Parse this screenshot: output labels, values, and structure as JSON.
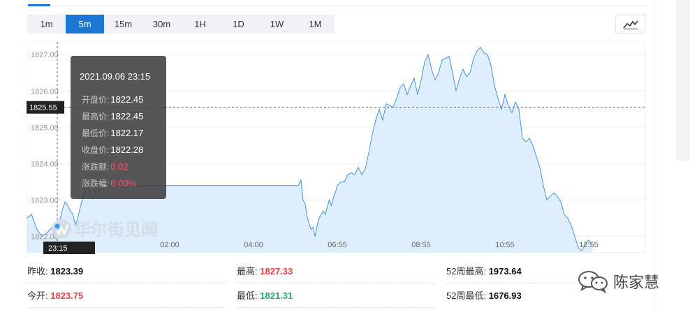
{
  "timeframe_tabs": [
    {
      "label": "1m",
      "active": false
    },
    {
      "label": "5m",
      "active": true
    },
    {
      "label": "15m",
      "active": false
    },
    {
      "label": "30m",
      "active": false
    },
    {
      "label": "1H",
      "active": false
    },
    {
      "label": "1D",
      "active": false
    },
    {
      "label": "1W",
      "active": false
    },
    {
      "label": "1M",
      "active": false
    }
  ],
  "chart_type_icon": "line-chart-icon",
  "chart_data": {
    "type": "area",
    "series": [
      {
        "x": [
          "22:45",
          "22:50",
          "22:55",
          "23:00",
          "23:05",
          "23:10",
          "23:15",
          "23:20",
          "23:25",
          "23:30",
          "23:35",
          "23:40",
          "23:45",
          "23:50",
          "23:55",
          "00:00",
          "00:05",
          "00:10",
          "00:15",
          "00:20",
          "00:25",
          "00:30",
          "01:00",
          "02:00",
          "03:00",
          "04:00",
          "05:00",
          "05:20",
          "05:25",
          "05:30",
          "05:35",
          "05:40",
          "05:45",
          "05:50",
          "05:55",
          "06:00",
          "06:05",
          "06:10",
          "06:15",
          "06:20",
          "06:25",
          "06:30",
          "06:35",
          "06:40",
          "06:45",
          "06:50",
          "06:55",
          "07:00",
          "07:05",
          "07:10",
          "07:15",
          "07:20",
          "07:25",
          "07:30",
          "07:35",
          "07:40",
          "07:45",
          "07:50",
          "07:55",
          "08:00",
          "08:05",
          "08:10",
          "08:15",
          "08:20",
          "08:25",
          "08:30",
          "08:35",
          "08:40",
          "08:45",
          "08:50",
          "08:55",
          "09:00",
          "09:05",
          "09:10",
          "09:15",
          "09:20",
          "09:25",
          "09:30",
          "09:35",
          "09:40",
          "09:45",
          "09:50",
          "09:55",
          "10:00",
          "10:05",
          "10:10",
          "10:15",
          "10:20",
          "10:25",
          "10:30",
          "10:35",
          "10:40",
          "10:45",
          "10:50",
          "10:55",
          "11:00",
          "11:05",
          "11:10",
          "11:15",
          "11:20",
          "11:25",
          "11:30",
          "11:35",
          "11:40",
          "11:45",
          "11:50",
          "11:55",
          "12:00",
          "12:05",
          "12:10",
          "12:15",
          "12:20",
          "12:25",
          "12:30",
          "12:35",
          "12:40",
          "12:45",
          "12:50",
          "12:55",
          "13:00"
        ],
        "values": [
          1822.5,
          1822.6,
          1822.2,
          1822.0,
          1822.1,
          1822.25,
          1822.28,
          1822.45,
          1822.75,
          1822.95,
          1822.85,
          1822.7,
          1822.6,
          1822.3,
          1822.55,
          1822.85,
          1823.15,
          1823.45,
          1823.35,
          1823.1,
          1823.05,
          1823.4,
          1823.4,
          1823.4,
          1823.4,
          1823.4,
          1823.4,
          1823.4,
          1823.55,
          1823.0,
          1822.9,
          1822.55,
          1822.35,
          1822.2,
          1822.25,
          1822.0,
          1822.3,
          1822.5,
          1822.6,
          1822.7,
          1822.6,
          1822.8,
          1823.0,
          1822.85,
          1823.05,
          1823.2,
          1823.4,
          1823.5,
          1823.5,
          1823.7,
          1823.75,
          1823.7,
          1823.9,
          1823.7,
          1823.85,
          1824.3,
          1824.8,
          1825.2,
          1825.5,
          1825.2,
          1825.65,
          1825.6,
          1825.55,
          1825.8,
          1826.1,
          1826.2,
          1825.9,
          1826.15,
          1826.35,
          1825.9,
          1826.3,
          1826.8,
          1827.0,
          1826.6,
          1826.3,
          1826.5,
          1826.85,
          1826.9,
          1826.95,
          1826.5,
          1826.0,
          1826.35,
          1826.6,
          1826.4,
          1826.5,
          1826.9,
          1827.1,
          1827.2,
          1827.05,
          1827.0,
          1826.7,
          1826.15,
          1825.8,
          1825.5,
          1825.9,
          1825.6,
          1825.4,
          1825.7,
          1825.5,
          1824.7,
          1824.6,
          1824.7,
          1824.5,
          1824.2,
          1823.9,
          1823.4,
          1823.0,
          1823.1,
          1823.2,
          1823.1,
          1822.95,
          1822.6,
          1822.5,
          1822.3,
          1822.0,
          1821.7,
          1821.6,
          1821.8,
          1821.9,
          1821.75
        ],
        "fill": "#dfeefc",
        "stroke": "#4a90d9"
      }
    ],
    "ylim": [
      1821.55,
      1827.35
    ],
    "y_ticks": [
      "1822.00",
      "1823.00",
      "1824.00",
      "1825.00",
      "1826.00",
      "1827.00"
    ],
    "x_ticks": [
      "02:00",
      "04:00",
      "06:55",
      "08:55",
      "10:55",
      "12:55"
    ],
    "grid": true,
    "crosshair": {
      "x_label": "23:15",
      "y_label": "1825.55",
      "y_value": 1825.55,
      "x_value": "23:15"
    },
    "watermark": "华尔街见闻"
  },
  "tooltip": {
    "date": "2021.09.06 23:15",
    "rows": [
      {
        "label": "开盘价:",
        "value": "1822.45",
        "color": "white"
      },
      {
        "label": "最高价:",
        "value": "1822.45",
        "color": "white"
      },
      {
        "label": "最低价:",
        "value": "1822.17",
        "color": "white"
      },
      {
        "label": "收盘价:",
        "value": "1822.28",
        "color": "white"
      },
      {
        "label": "涨跌额:",
        "value": "0.02",
        "color": "red"
      },
      {
        "label": "涨跌幅:",
        "value": "0.00%",
        "color": "red"
      }
    ]
  },
  "stats": [
    {
      "label": "昨收:",
      "value": "1823.39",
      "color": "default"
    },
    {
      "label": "最高:",
      "value": "1827.33",
      "color": "red"
    },
    {
      "label": "52周最高:",
      "value": "1973.64",
      "color": "default"
    },
    {
      "label": "今开:",
      "value": "1823.75",
      "color": "red"
    },
    {
      "label": "最低:",
      "value": "1821.31",
      "color": "green"
    },
    {
      "label": "52周最低:",
      "value": "1676.93",
      "color": "default"
    }
  ],
  "wechat_badge": {
    "icon": "wechat-icon",
    "name": "陈家慧"
  },
  "colors": {
    "accent": "#1e77d3",
    "up": "#e3414e",
    "down": "#2aaa74"
  }
}
